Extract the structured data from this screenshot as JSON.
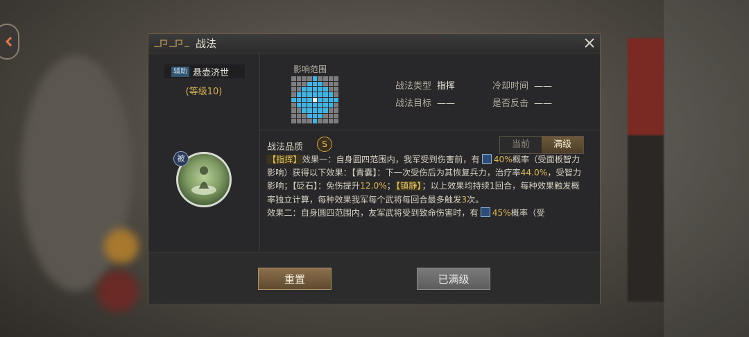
{
  "dialog": {
    "title": "战法"
  },
  "skill": {
    "tag": "辅助",
    "name": "悬壶济世",
    "level_text": "(等级10)",
    "passive_badge": "被"
  },
  "range": {
    "label": "影响范围"
  },
  "info": {
    "type_label": "战法类型",
    "type_value": "指挥",
    "target_label": "战法目标",
    "target_value": "——",
    "cooldown_label": "冷却时间",
    "cooldown_value": "——",
    "counter_label": "是否反击",
    "counter_value": "——"
  },
  "quality": {
    "label": "战法品质",
    "grade": "S"
  },
  "tabs": {
    "current": "当前",
    "max": "满级"
  },
  "description": {
    "p1_tag": "【指挥】",
    "p1_a": "效果一：自身圆四范围内，我军受到伤害前，有",
    "p1_prob": "40%",
    "p1_b": "概率（受面板智力影响）获得以下效果：【青囊】：下一次受伤后为其恢复兵力，治疗率",
    "p1_heal": "44.0%",
    "p1_c": "，受智力影响；【砭石】：免伤提升",
    "p1_reduce": "12.0%",
    "p1_d": "；",
    "p1_tag2": "【镇静】",
    "p1_e": "；以上效果均持续1回合，每种效果触发概率独立计算，每种效果我军每个武将每回合最多触发",
    "p1_times": "3",
    "p1_f": "次。",
    "p2_a": "效果二：自身圆四范围内，友军武将受到致命伤害时，有",
    "p2_prob": "45%",
    "p2_b": "概率（受"
  },
  "buttons": {
    "reset": "重置",
    "maxed": "已满级"
  },
  "colors": {
    "accent_gold": "#d9b753",
    "range_blue": "#3fb3e4"
  },
  "icons": [
    "back-icon",
    "close-icon",
    "probability-icon",
    "ornament-icon"
  ]
}
